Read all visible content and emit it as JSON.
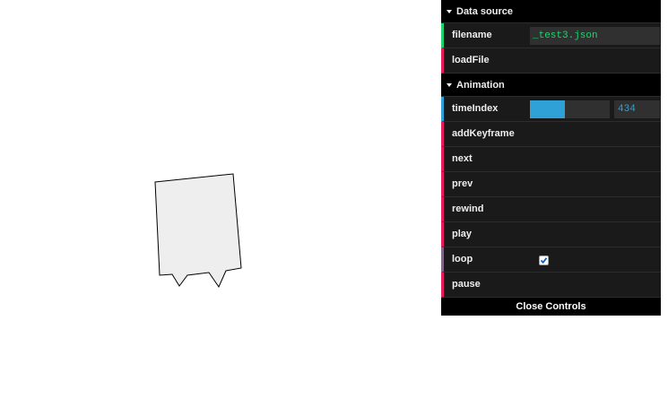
{
  "gui": {
    "folders": [
      {
        "title": "Data source",
        "controls": [
          {
            "label": "filename",
            "kind": "string",
            "value": "_test3.json"
          },
          {
            "label": "loadFile",
            "kind": "function"
          }
        ]
      },
      {
        "title": "Animation",
        "controls": [
          {
            "label": "timeIndex",
            "kind": "number",
            "value": "434",
            "fraction": 0.44
          },
          {
            "label": "addKeyframe",
            "kind": "function"
          },
          {
            "label": "next",
            "kind": "function"
          },
          {
            "label": "prev",
            "kind": "function"
          },
          {
            "label": "rewind",
            "kind": "function"
          },
          {
            "label": "play",
            "kind": "function"
          },
          {
            "label": "loop",
            "kind": "boolean",
            "checked": true
          },
          {
            "label": "pause",
            "kind": "function"
          }
        ]
      }
    ],
    "close_label": "Close Controls"
  },
  "colors": {
    "string_accent": "#1ed36f",
    "number_accent": "#2fa1d6",
    "boolean_accent": "#806787",
    "function_accent": "#e61d5f",
    "shape_fill": "#eeeeee"
  }
}
